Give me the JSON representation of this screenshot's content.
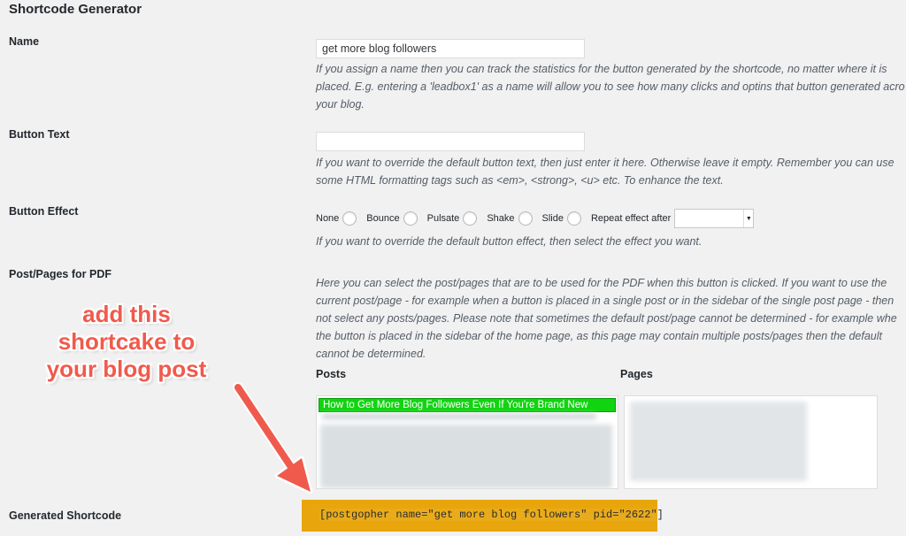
{
  "section_title": "Shortcode Generator",
  "name_field": {
    "label": "Name",
    "value": "get more blog followers",
    "desc_lines": [
      "If you assign a name then you can track the statistics for the button generated by the shortcode, no matter where it is",
      "placed. E.g. entering a 'leadbox1' as a name will allow you to see how many clicks and optins that button generated acro",
      "your blog."
    ]
  },
  "button_text_field": {
    "label": "Button Text",
    "value": "",
    "desc_lines": [
      "If you want to override the default button text, then just enter it here. Otherwise leave it empty. Remember you can use",
      "some HTML formatting tags such as <em>, <strong>, <u> etc. To enhance the text."
    ]
  },
  "button_effect": {
    "label": "Button Effect",
    "options": [
      "None",
      "Bounce",
      "Pulsate",
      "Shake",
      "Slide"
    ],
    "repeat_label": "Repeat effect after",
    "repeat_value": "",
    "desc": "If you want to override the default button effect, then select the effect you want."
  },
  "post_pages": {
    "label": "Post/Pages for PDF",
    "desc_lines": [
      "Here you can select the post/pages that are to be used for the PDF when this button is clicked. If you want to use the",
      "current post/page - for example when a button is placed in a single post or in the sidebar of the single post page - then",
      "not select any posts/pages. Please note that sometimes the default post/page cannot be determined - for example whe",
      "the button is placed in the sidebar of the home page, as this page may contain multiple posts/pages then the default",
      "cannot be determined."
    ],
    "posts_heading": "Posts",
    "pages_heading": "Pages",
    "selected_post": "How to Get More Blog Followers Even If You're Brand New"
  },
  "overlay": {
    "lines": [
      "add this",
      "shortcake to",
      "your blog post"
    ],
    "color": "#f05a4c"
  },
  "generated_shortcode": {
    "label": "Generated Shortcode",
    "value": "[postgopher name=\"get more blog followers\" pid=\"2622\"]",
    "highlight_color": "#e8a60c"
  },
  "colors": {
    "background": "#f1f1f1",
    "selected_item": "#11d411"
  }
}
